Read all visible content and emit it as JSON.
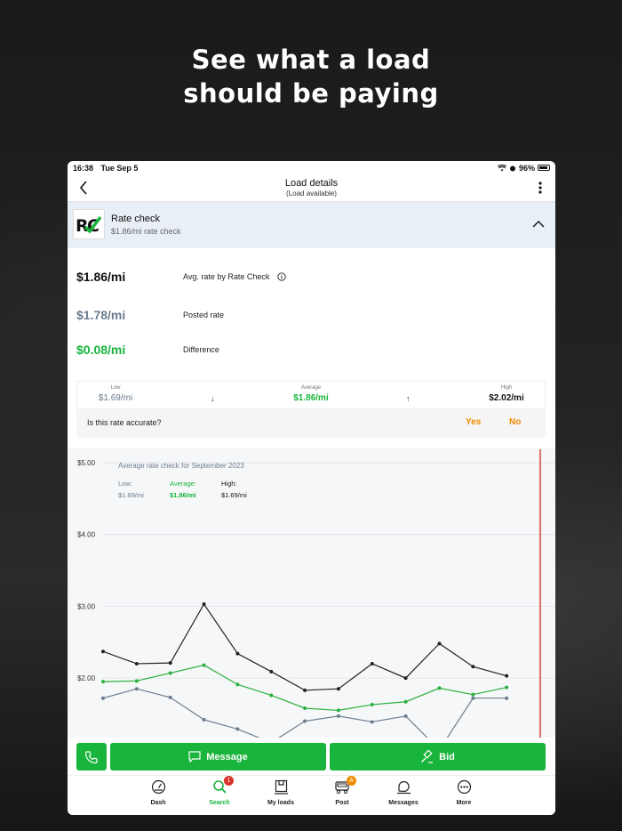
{
  "headline": {
    "line1": "See what a load",
    "line2": "should be paying"
  },
  "status_bar": {
    "time": "16:38",
    "date": "Tue Sep 5",
    "battery": "96%"
  },
  "navbar": {
    "title": "Load details",
    "subtitle": "(Load available)"
  },
  "rate_check": {
    "logo_text": "RC",
    "title": "Rate check",
    "subtitle": "$1.86/mi rate check"
  },
  "rates": [
    {
      "value": "$1.86/mi",
      "label": "Avg. rate by Rate Check",
      "color": "#111111"
    },
    {
      "value": "$1.78/mi",
      "label": "Posted rate",
      "color": "#6b7c8f"
    },
    {
      "value": "$0.08/mi",
      "label": "Difference",
      "color": "#18b43b"
    }
  ],
  "range": {
    "low_caption": "Low",
    "low_value": "$1.69/mi",
    "avg_caption": "Average",
    "avg_value": "$1.86/mi",
    "high_caption": "High",
    "high_value": "$2.02/mi",
    "down_arrow": "↓",
    "up_arrow": "↑"
  },
  "accuracy": {
    "question": "Is this rate accurate?",
    "yes": "Yes",
    "no": "No"
  },
  "chart_data": {
    "type": "line",
    "title": "Average rate check for September 2023",
    "legend": {
      "low_label": "Low:",
      "low_value": "$1.69/mi",
      "avg_label": "Average:",
      "avg_value": "$1.86/mi",
      "high_label": "High:",
      "high_value": "$1.69/mi"
    },
    "y_ticks": [
      "$5.00",
      "$4.00",
      "$3.00",
      "$2.00"
    ],
    "ylim": [
      1.2,
      5.0
    ],
    "grid": true,
    "x": [
      1,
      2,
      3,
      4,
      5,
      6,
      7,
      8,
      9,
      10,
      11,
      12,
      13,
      14
    ],
    "series": [
      {
        "name": "High",
        "color": "#222222",
        "values": [
          2.37,
          2.2,
          2.21,
          3.03,
          2.34,
          2.09,
          1.83,
          1.85,
          2.2,
          2.0,
          2.48,
          2.16,
          2.03,
          null
        ]
      },
      {
        "name": "Average",
        "color": "#2ab13f",
        "values": [
          1.95,
          1.96,
          2.07,
          2.18,
          1.91,
          1.76,
          1.58,
          1.55,
          1.63,
          1.67,
          1.86,
          1.77,
          1.87,
          null
        ]
      },
      {
        "name": "Low",
        "color": "#6b7c8f",
        "values": [
          1.72,
          1.85,
          1.73,
          1.42,
          1.29,
          1.1,
          1.4,
          1.47,
          1.39,
          1.47,
          1.0,
          1.72,
          1.72,
          null
        ]
      }
    ],
    "marker_line_color": "#d9342b"
  },
  "actions": {
    "message": "Message",
    "bid": "Bid"
  },
  "tabs": [
    {
      "label": "Dash",
      "icon": "dashboard-icon"
    },
    {
      "label": "Search",
      "icon": "search-icon",
      "badge": "1",
      "badge_color": "#d9342b"
    },
    {
      "label": "My loads",
      "icon": "box-icon"
    },
    {
      "label": "Post",
      "icon": "truck-icon",
      "badge": "A",
      "badge_color": "#f08a00"
    },
    {
      "label": "Messages",
      "icon": "chat-icon"
    },
    {
      "label": "More",
      "icon": "more-icon"
    }
  ],
  "colors": {
    "accent": "#18b43b",
    "warning": "#f08a00",
    "header_bg": "#e9eff6"
  }
}
